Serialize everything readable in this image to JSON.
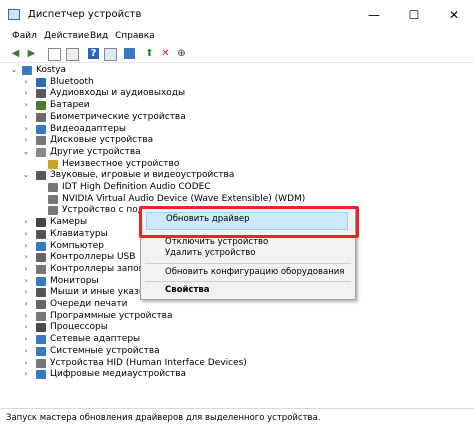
{
  "window": {
    "title": "Диспетчер устройств",
    "minimize": "—",
    "maximize": "☐",
    "close": "✕"
  },
  "menu": [
    "Файл",
    "Действие",
    "Вид",
    "Справка"
  ],
  "tree": {
    "root": "Kostya",
    "items": [
      {
        "label": "Bluetooth",
        "icon": "bluetooth-icon"
      },
      {
        "label": "Аудиовходы и аудиовыходы",
        "icon": "audio-io-icon"
      },
      {
        "label": "Батареи",
        "icon": "battery-icon"
      },
      {
        "label": "Биометрические устройства",
        "icon": "biometric-icon"
      },
      {
        "label": "Видеоадаптеры",
        "icon": "display-adapter-icon"
      },
      {
        "label": "Дисковые устройства",
        "icon": "disk-icon"
      },
      {
        "label": "Другие устройства",
        "icon": "other-devices-icon"
      },
      {
        "label": "Неизвестное устройство",
        "icon": "unknown-device-icon"
      },
      {
        "label": "Звуковые, игровые и видеоустройства",
        "icon": "sound-icon"
      },
      {
        "label": "IDT High Definition Audio CODEC",
        "icon": "speaker-icon"
      },
      {
        "label": "NVIDIA Virtual Audio Device (Wave Extensible) (WDM)",
        "icon": "speaker-icon"
      },
      {
        "label": "Устройство с поддер",
        "icon": "speaker-icon"
      },
      {
        "label": "Камеры",
        "icon": "camera-icon"
      },
      {
        "label": "Клавиатуры",
        "icon": "keyboard-icon"
      },
      {
        "label": "Компьютер",
        "icon": "computer-icon"
      },
      {
        "label": "Контроллеры USB",
        "icon": "usb-icon"
      },
      {
        "label": "Контроллеры запомина",
        "icon": "storage-controller-icon"
      },
      {
        "label": "Мониторы",
        "icon": "monitor-icon"
      },
      {
        "label": "Мыши и иные указыва",
        "icon": "mouse-icon"
      },
      {
        "label": "Очереди печати",
        "icon": "printer-icon"
      },
      {
        "label": "Программные устройства",
        "icon": "software-device-icon"
      },
      {
        "label": "Процессоры",
        "icon": "processor-icon"
      },
      {
        "label": "Сетевые адаптеры",
        "icon": "network-icon"
      },
      {
        "label": "Системные устройства",
        "icon": "system-icon"
      },
      {
        "label": "Устройства HID (Human Interface Devices)",
        "icon": "hid-icon"
      },
      {
        "label": "Цифровые медиаустройства",
        "icon": "media-icon"
      }
    ]
  },
  "context_menu": {
    "update_driver": "Обновить драйвер",
    "disable": "Отключить устройство",
    "uninstall": "Удалить устройство",
    "scan": "Обновить конфигурацию оборудования",
    "properties": "Свойства"
  },
  "status": "Запуск мастера обновления драйверов для выделенного устройства.",
  "colors": {
    "highlight": "#e8252a",
    "selection": "#cde8ff"
  }
}
